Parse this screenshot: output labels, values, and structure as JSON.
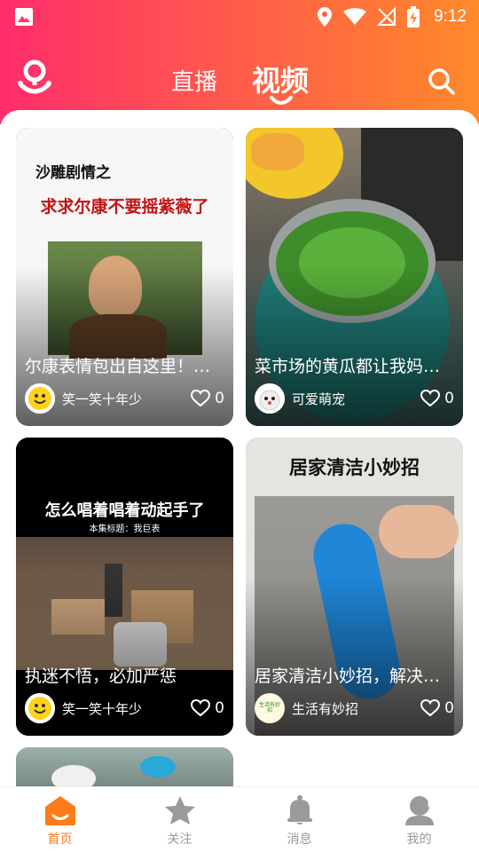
{
  "status_bar": {
    "time": "9:12"
  },
  "header": {
    "tabs": [
      {
        "label": "直播",
        "active": false
      },
      {
        "label": "视频",
        "active": true
      }
    ],
    "search_icon": "search-icon",
    "logo_icon": "app-logo-icon"
  },
  "cards": [
    {
      "title": "尔康表情包出自这里！尔康不要摇紫薇了",
      "author": "笑一笑十年少",
      "likes": "0",
      "thumb_caption_1": "沙雕剧情之",
      "thumb_caption_2": "求求尔康不要摇紫薇了"
    },
    {
      "title": "菜市场的黄瓜都让我妈买光了",
      "author": "可爱萌宠",
      "likes": "0"
    },
    {
      "title": "执迷不悟，必加严惩",
      "author": "笑一笑十年少",
      "likes": "0",
      "thumb_caption_1": "怎么唱着唱着动起手了",
      "thumb_caption_2": "本集标题：我巨表"
    },
    {
      "title": "居家清洁小妙招，解决大难题",
      "author": "生活有妙招",
      "likes": "0",
      "thumb_caption_1": "居家清洁小妙招",
      "avatar_text": "生活有妙招"
    }
  ],
  "bottom_nav": [
    {
      "label": "首页",
      "icon": "home-icon",
      "active": true
    },
    {
      "label": "关注",
      "icon": "star-icon",
      "active": false
    },
    {
      "label": "消息",
      "icon": "bell-icon",
      "active": false
    },
    {
      "label": "我的",
      "icon": "profile-icon",
      "active": false
    }
  ],
  "colors": {
    "accent": "#ff7a1a",
    "gradient_start": "#ff2d6b",
    "gradient_end": "#ff8a2a"
  }
}
